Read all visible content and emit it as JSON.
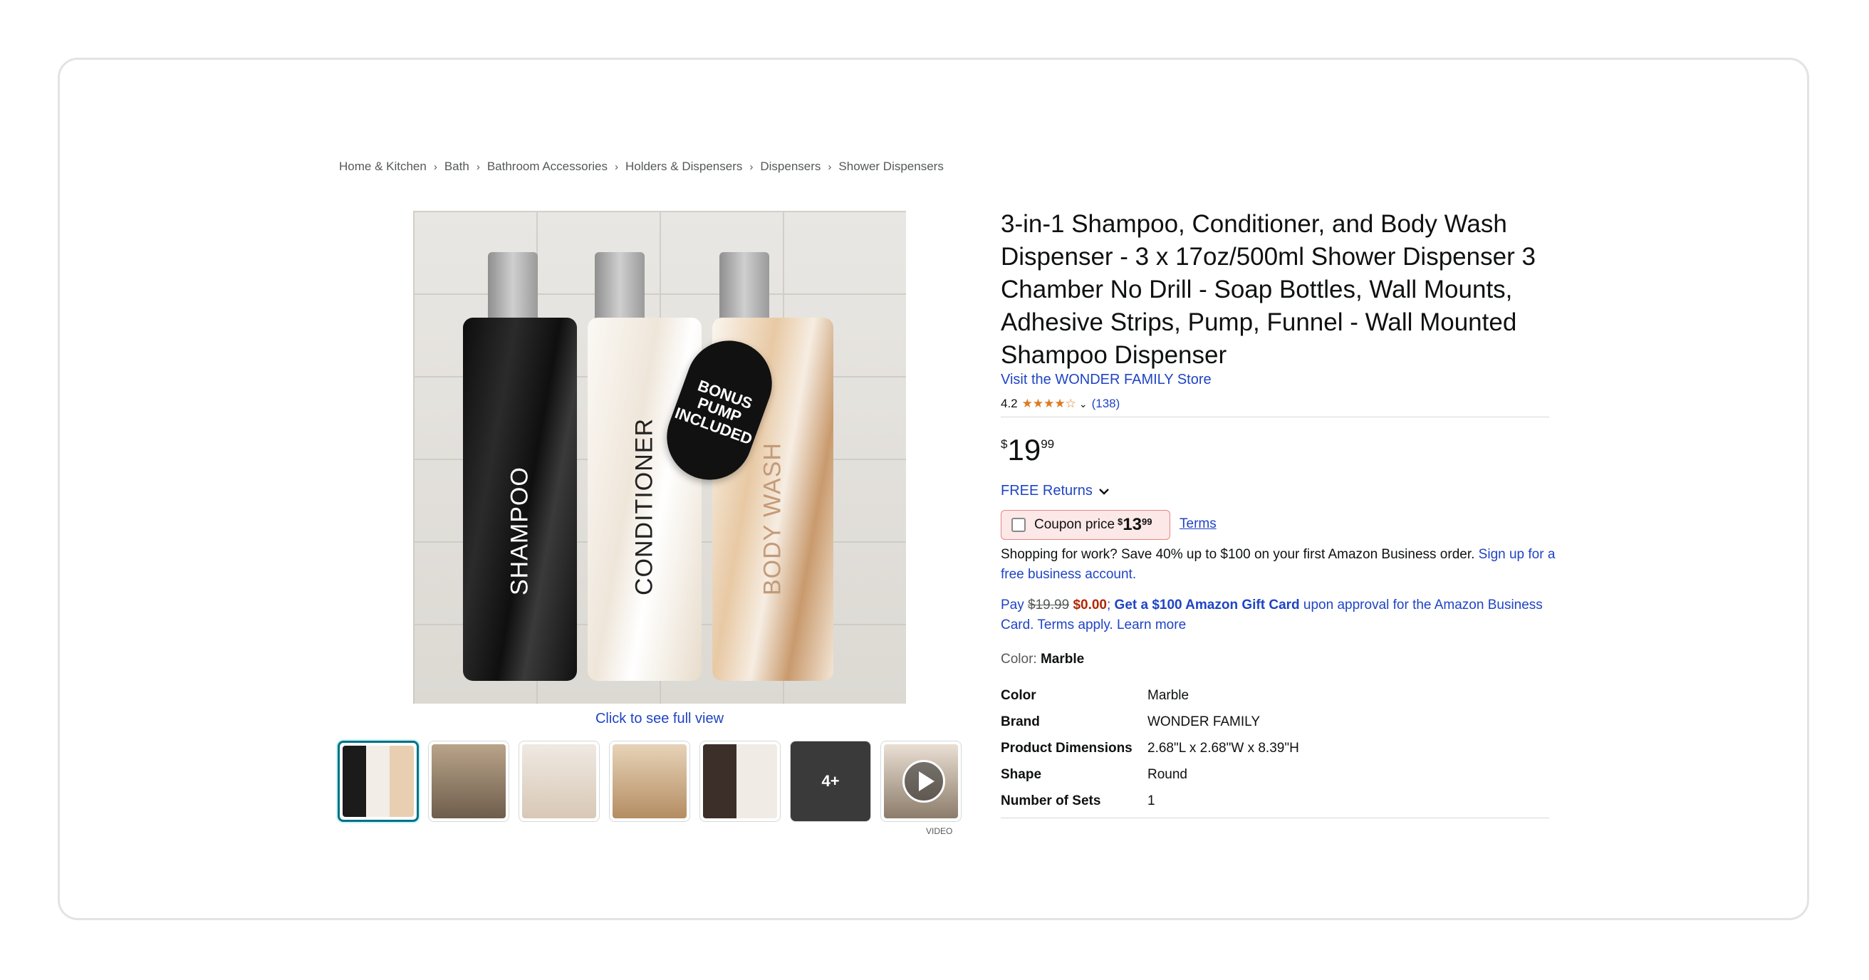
{
  "breadcrumb": [
    "Home & Kitchen",
    "Bath",
    "Bathroom Accessories",
    "Holders & Dispensers",
    "Dispensers",
    "Shower Dispensers"
  ],
  "breadcrumb_sep": "›",
  "product": {
    "title": "3-in-1 Shampoo, Conditioner, and Body Wash Dispenser - 3 x 17oz/500ml Shower Dispenser 3 Chamber No Drill - Soap Bottles, Wall Mounts, Adhesive Strips, Pump, Funnel - Wall Mounted Shampoo Dispenser",
    "store_link": "Visit the WONDER FAMILY Store",
    "rating_value": "4.2",
    "rating_stars": "★★★★☆",
    "rating_count": "(138)",
    "price_currency": "$",
    "price_whole": "19",
    "price_fraction": "99"
  },
  "image": {
    "bottle_labels": [
      "SHAMPOO",
      "CONDITIONER",
      "BODY WASH"
    ],
    "tag_text": "BONUS PUMP INCLUDED",
    "full_view_link": "Click to see full view",
    "more_label": "4+",
    "video_caption": "VIDEO"
  },
  "returns": {
    "label": "FREE Returns"
  },
  "coupon": {
    "label": "Coupon price",
    "currency": "$",
    "whole": "13",
    "fraction": "99",
    "terms": "Terms"
  },
  "business": {
    "text": "Shopping for work? Save 40% up to $100 on your first Amazon Business order.",
    "link": "Sign up for a free business account."
  },
  "card_offer": {
    "pay": "Pay",
    "old_price": "$19.99",
    "new_price": "$0.00",
    "sep": ";",
    "gift": "Get a $100 Amazon Gift Card",
    "rest": "upon approval for the Amazon Business Card. Terms apply.",
    "learn": "Learn more"
  },
  "color": {
    "label": "Color:",
    "value": "Marble"
  },
  "specs": [
    {
      "k": "Color",
      "v": "Marble"
    },
    {
      "k": "Brand",
      "v": "WONDER FAMILY"
    },
    {
      "k": "Product Dimensions",
      "v": "2.68\"L x 2.68\"W x 8.39\"H"
    },
    {
      "k": "Shape",
      "v": "Round"
    },
    {
      "k": "Number of Sets",
      "v": "1"
    }
  ],
  "colors": {
    "link": "#1f44c4",
    "price_red": "#b12704",
    "star": "#de7921",
    "selected_thumb": "#007185"
  }
}
